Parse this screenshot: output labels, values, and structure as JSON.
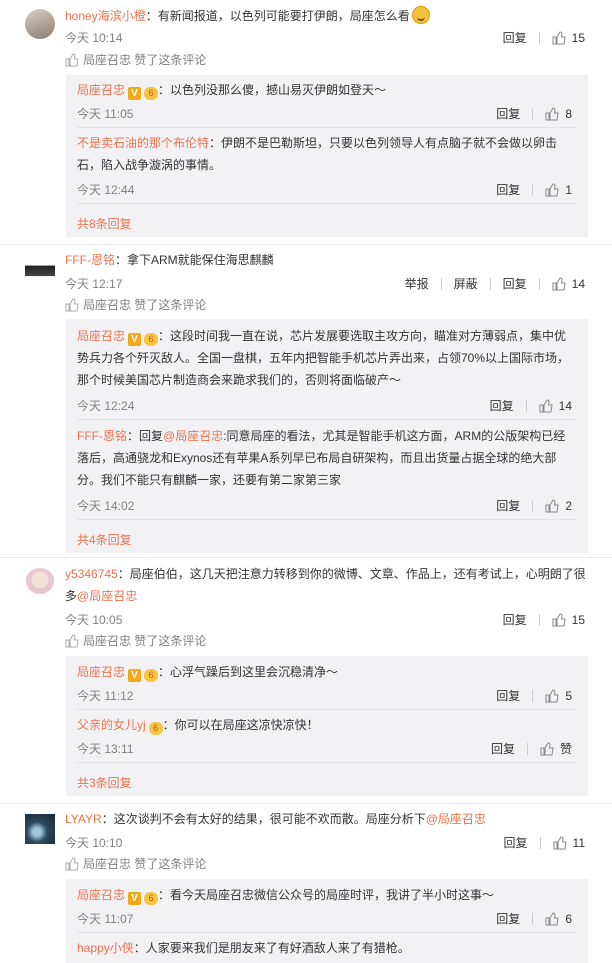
{
  "comments": [
    {
      "user": "honey海滨小橙",
      "text": "有新闻报道，以色列可能要打伊朗，局座怎么看",
      "time": "今天 10:14",
      "reply_label": "回复",
      "likes": "15",
      "liked_by": "局座召忠 赞了这条评论",
      "replies": [
        {
          "user": "局座召忠",
          "text": "：以色列没那么傻，撼山易灭伊朗如登天～",
          "time": "今天 11:05",
          "likes": "8"
        },
        {
          "user": "不是卖石油的那个布伦特",
          "text": "：伊朗不是巴勒斯坦，只要以色列领导人有点脑子就不会做以卵击石，陷入战争漩涡的事情。",
          "time": "今天 12:44",
          "likes": "1"
        }
      ],
      "more": "共8条回复"
    },
    {
      "user": "FFF-恩铭",
      "text": "：拿下ARM就能保住海思麒麟",
      "time": "今天 12:17",
      "report_label": "举报",
      "block_label": "屏蔽",
      "reply_label": "回复",
      "likes": "14",
      "liked_by": "局座召忠 赞了这条评论",
      "replies": [
        {
          "user": "局座召忠",
          "text": "：这段时间我一直在说，芯片发展要选取主攻方向，瞄准对方薄弱点，集中优势兵力各个歼灭敌人。全国一盘棋，五年内把智能手机芯片弄出来，占领70%以上国际市场，那个时候美国芯片制造商会来跪求我们的，否则将面临破产～",
          "time": "今天 12:24",
          "likes": "14"
        },
        {
          "user": "FFF-恩铭",
          "reply_prefix": "：回复",
          "mention": "@局座召忠",
          "text": ":同意局座的看法，尤其是智能手机这方面，ARM的公版架构已经落后，高通骁龙和Exynos还有苹果A系列早已布局自研架构，而且出货量占据全球的绝大部分。我们不能只有麒麟一家，还要有第二家第三家",
          "time": "今天 14:02",
          "likes": "2"
        }
      ],
      "more": "共4条回复"
    },
    {
      "user": "y5346745",
      "text": "：局座伯伯，这几天把注意力转移到你的微博、文章、作品上，还有考试上，心明朗了很多",
      "mention": "@局座召忠",
      "time": "今天 10:05",
      "reply_label": "回复",
      "likes": "15",
      "liked_by": "局座召忠 赞了这条评论",
      "replies": [
        {
          "user": "局座召忠",
          "text": "：心浮气躁后到这里会沉稳清净～",
          "time": "今天 11:12",
          "likes": "5"
        },
        {
          "user": "父亲的女儿yj",
          "text": "：你可以在局座这凉快凉快！",
          "time": "今天 13:11",
          "likes": "赞"
        }
      ],
      "more": "共3条回复"
    },
    {
      "user": "LYAYR",
      "text": "：这次谈判不会有太好的结果，很可能不欢而散。局座分析下",
      "mention": "@局座召忠",
      "time": "今天 10:10",
      "reply_label": "回复",
      "likes": "11",
      "liked_by": "局座召忠 赞了这条评论",
      "replies": [
        {
          "user": "局座召忠",
          "text": "：看今天局座召忠微信公众号的局座时评，我讲了半小时这事～",
          "time": "今天 11:07",
          "likes": "6"
        },
        {
          "user": "happy小侠",
          "text": "：人家要来我们是朋友来了有好酒敌人来了有猎枪。",
          "time": "",
          "likes": ""
        }
      ]
    }
  ],
  "badges": {
    "v": "V",
    "lv": "6"
  },
  "colors": {
    "username": "#eb7350",
    "reply_bg": "#f2f2f5",
    "text": "#333333",
    "meta": "#808080"
  }
}
